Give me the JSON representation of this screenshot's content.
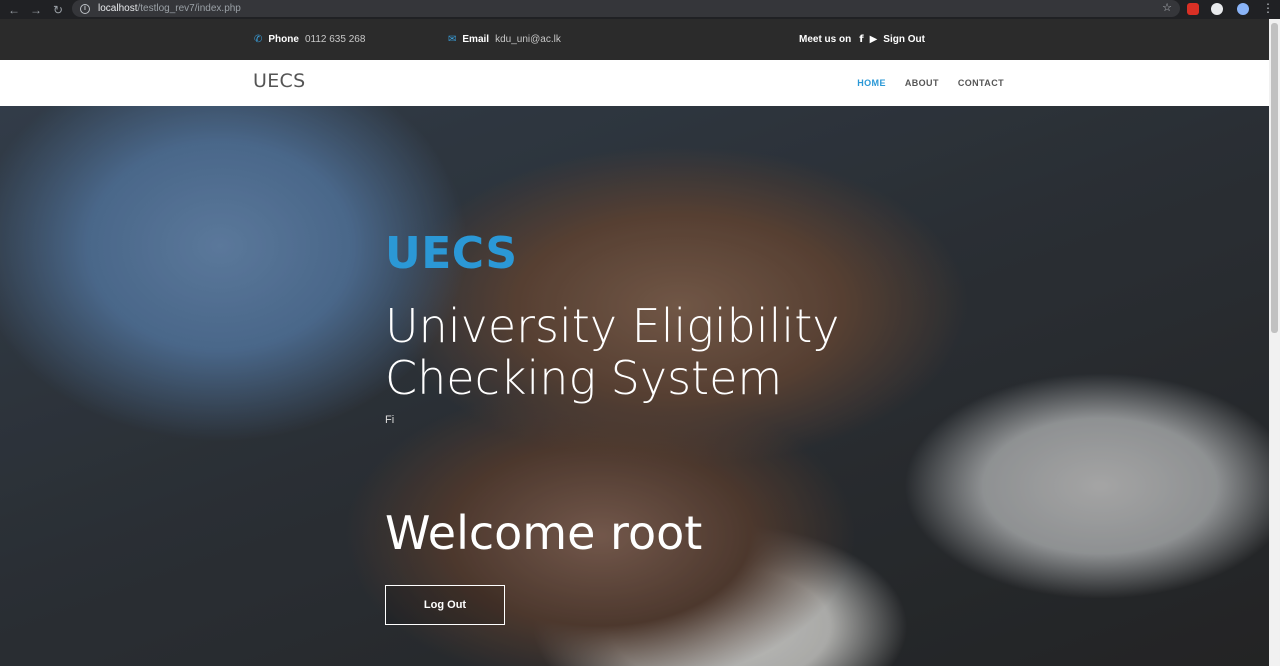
{
  "browser": {
    "url_host": "localhost",
    "url_path": "/testlog_rev7/index.php"
  },
  "topbar": {
    "phone_label": "Phone",
    "phone_value": "0112 635 268",
    "email_label": "Email",
    "email_value": "kdu_uni@ac.lk",
    "social_label": "Meet us on",
    "signout": "Sign Out"
  },
  "navbar": {
    "brand": "UECS",
    "menu": [
      "HOME",
      "ABOUT",
      "CONTACT"
    ]
  },
  "hero": {
    "title": "UECS",
    "subtitle": "University Eligibility Checking System",
    "small_text": "Fi",
    "welcome": "Welcome root",
    "logout_button": "Log Out"
  },
  "colors": {
    "accent": "#2b98d6",
    "topbar_bg": "#2b2b2b"
  },
  "icons": {
    "phone": "phone-icon",
    "email": "envelope-icon",
    "facebook": "facebook-icon",
    "youtube": "youtube-icon"
  }
}
